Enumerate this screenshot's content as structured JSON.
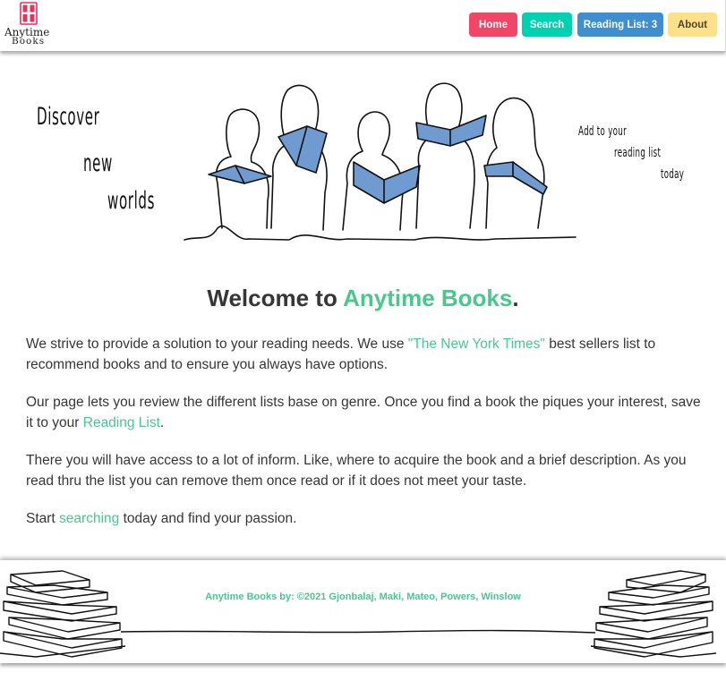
{
  "brand": {
    "line1": "Anytime",
    "line2": "Books",
    "logo_icon": "bookshelf-icon",
    "logo_color": "#e0365c"
  },
  "nav": {
    "home": "Home",
    "search": "Search",
    "reading_list": "Reading List: 3",
    "about": "About"
  },
  "hero": {
    "left_line1": "Discover",
    "left_line2": "new",
    "left_line3": "worlds",
    "right_line1": "Add to your",
    "right_line2": "reading list",
    "right_line3": "today",
    "illustration": "people-reading-illustration"
  },
  "main": {
    "welcome_prefix": "Welcome to ",
    "welcome_brand": "Anytime Books",
    "welcome_suffix": ".",
    "p1_before": "We strive to provide a solution to your reading needs. We use ",
    "p1_link": "\"The New York Times\"",
    "p1_after": " best sellers list to recommend books and to ensure you always have options.",
    "p2_before": "Our page lets you review the different lists base on genre. Once you find a book the piques your interest, save it to your ",
    "p2_link": "Reading List",
    "p2_after": ".",
    "p3": "There you will have access to a lot of inform. Like, where to acquire the book and a brief description. As you read thru the list you can remove them once read or if it does not meet your taste.",
    "p4_before": "Start ",
    "p4_link": "searching",
    "p4_after": " today and find your passion."
  },
  "footer": {
    "credits": "Anytime Books by: ©2021 Gjonbalaj, Maki, Mateo, Powers, Winslow",
    "left_art": "book-stack-icon",
    "right_art": "book-stack-icon"
  },
  "colors": {
    "home": "#f14668",
    "search": "#00d1b2",
    "reading": "#3e8ed0",
    "about": "#ffe08a",
    "accent": "#48c78e",
    "book_blue": "#6f9bd1"
  }
}
